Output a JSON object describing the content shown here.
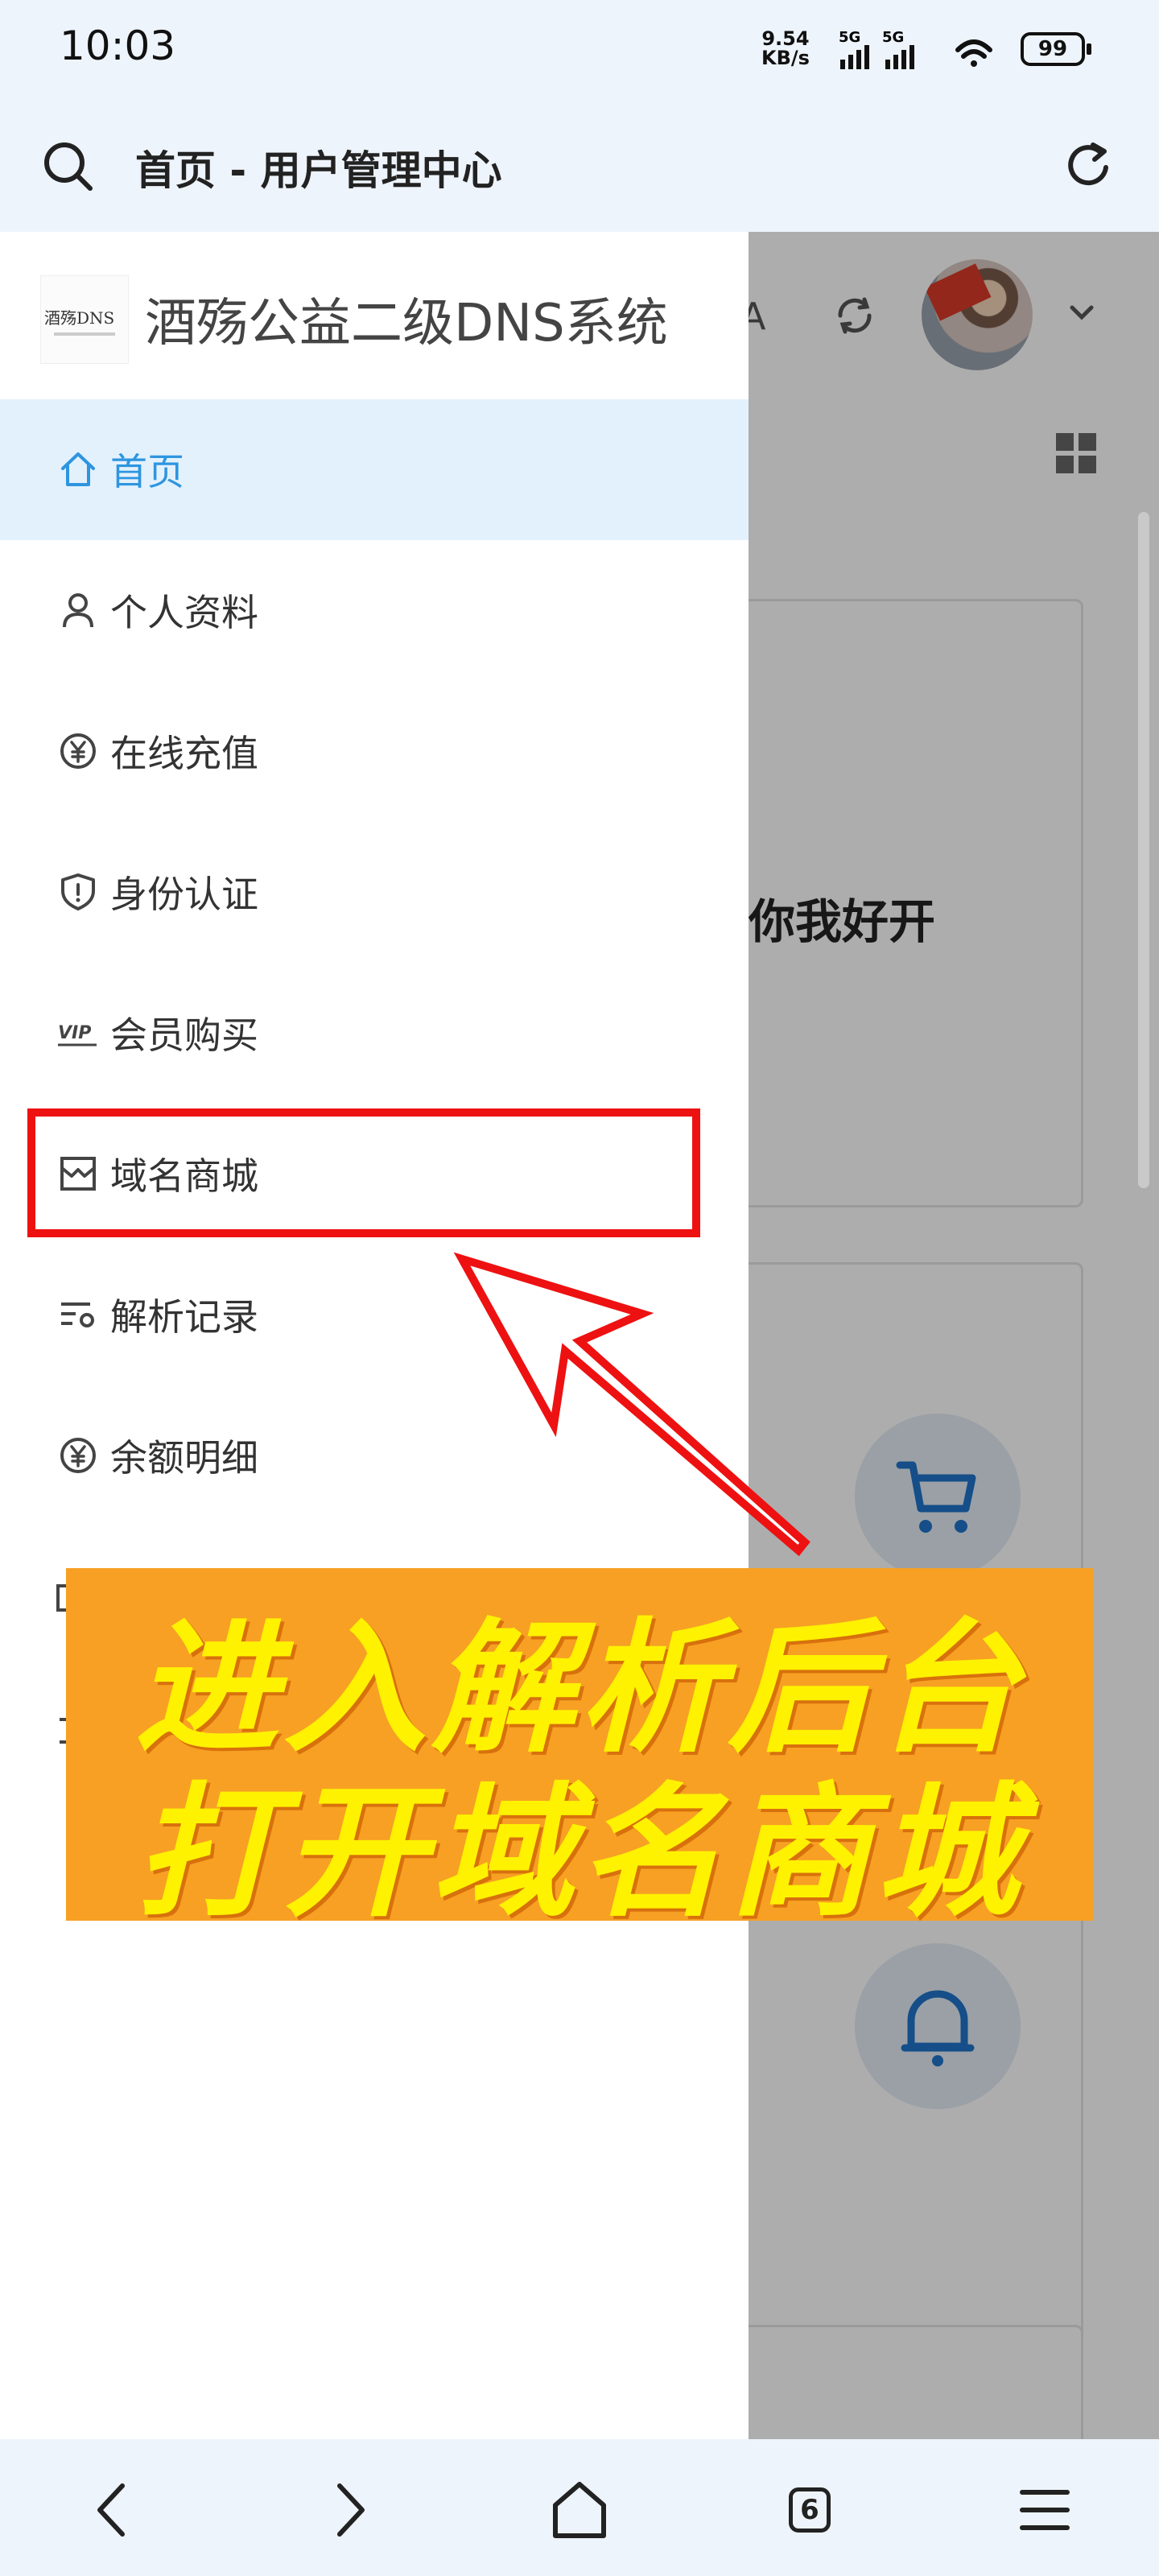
{
  "status_bar": {
    "time": "10:03",
    "net_speed_value": "9.54",
    "net_speed_unit": "KB/s",
    "signal1": "5G",
    "signal2": "5G",
    "battery": "99"
  },
  "browser": {
    "page_title": "首页 - 用户管理中心",
    "tab_count": "6"
  },
  "drawer": {
    "logo_text": "酒殇DNS",
    "site_title": "酒殇公益二级DNS系统",
    "items": [
      {
        "label": "首页",
        "icon": "home-icon",
        "active": true
      },
      {
        "label": "个人资料",
        "icon": "user-icon",
        "active": false
      },
      {
        "label": "在线充值",
        "icon": "yuan-coin-icon",
        "active": false
      },
      {
        "label": "身份认证",
        "icon": "shield-icon",
        "active": false
      },
      {
        "label": "会员购买",
        "icon": "vip-icon",
        "active": false
      },
      {
        "label": "域名商城",
        "icon": "store-icon",
        "active": false
      },
      {
        "label": "解析记录",
        "icon": "list-settings-icon",
        "active": false
      },
      {
        "label": "余额明细",
        "icon": "yuan-coin-icon",
        "active": false
      }
    ]
  },
  "background_page": {
    "card_text": "你我好开",
    "header_partial_text": "A"
  },
  "annotation": {
    "line1": "进入解析后台",
    "line2": "打开域名商城"
  },
  "colors": {
    "accent": "#2e95e0",
    "active_bg": "#e3f1fd",
    "highlight": "#ee1111",
    "banner_bg": "#f7a024",
    "banner_text": "#fff200"
  }
}
